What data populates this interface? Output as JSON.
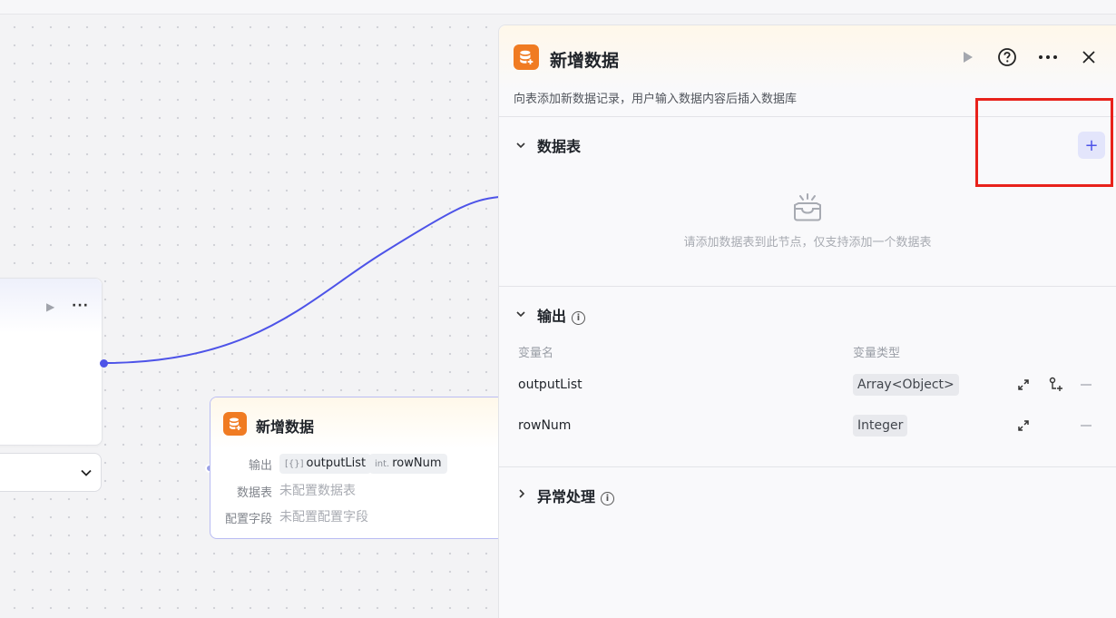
{
  "canvas": {
    "left_node": {
      "run_label": "▶",
      "more_label": "···"
    },
    "left_dropdown": {
      "chevron": "⌄"
    },
    "insert_node": {
      "title": "新增数据",
      "output_label": "输出",
      "output_chips": [
        {
          "prefix": "[{}]",
          "name": "outputList"
        },
        {
          "prefix": "int.",
          "name": "rowNum"
        }
      ],
      "table_label": "数据表",
      "table_value": "未配置数据表",
      "fields_label": "配置字段",
      "fields_value": "未配置配置字段"
    }
  },
  "panel": {
    "title": "新增数据",
    "description": "向表添加新数据记录，用户输入数据内容后插入数据库",
    "table_section": {
      "title": "数据表",
      "add_label": "+",
      "empty_text": "请添加数据表到此节点，仅支持添加一个数据表"
    },
    "output_section": {
      "title": "输出",
      "col_name": "变量名",
      "col_type": "变量类型",
      "rows": [
        {
          "name": "outputList",
          "type": "Array<Object>"
        },
        {
          "name": "rowNum",
          "type": "Integer"
        }
      ]
    },
    "exception_section": {
      "title": "异常处理"
    }
  },
  "colors": {
    "accent": "#4d53e8",
    "db_icon": "#f07b22",
    "highlight_box": "#e8221b"
  }
}
